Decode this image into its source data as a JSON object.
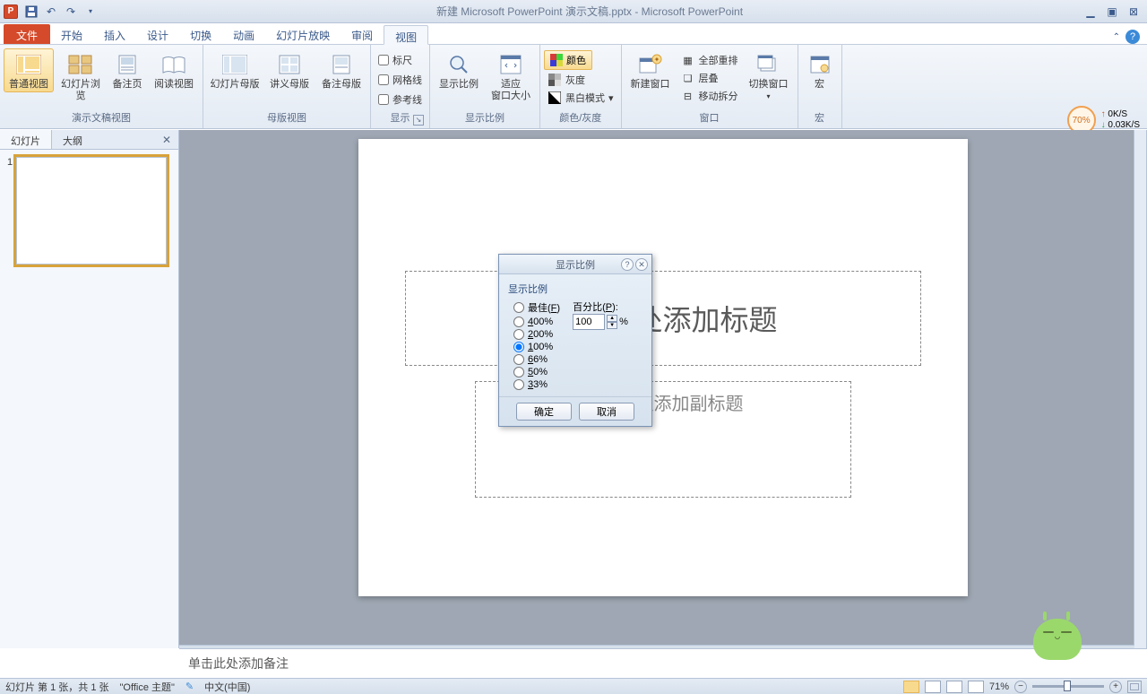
{
  "title_bar": {
    "app_letter": "P",
    "document_title": "新建 Microsoft PowerPoint 演示文稿.pptx - Microsoft PowerPoint"
  },
  "ribbon": {
    "file_tab": "文件",
    "tabs": [
      "开始",
      "插入",
      "设计",
      "切换",
      "动画",
      "幻灯片放映",
      "审阅",
      "视图"
    ],
    "active_tab": "视图",
    "groups": {
      "presentation_views": {
        "label": "演示文稿视图",
        "normal": "普通视图",
        "sorter": "幻灯片浏览",
        "notes_page": "备注页",
        "reading": "阅读视图"
      },
      "master_views": {
        "label": "母版视图",
        "slide_master": "幻灯片母版",
        "handout_master": "讲义母版",
        "notes_master": "备注母版"
      },
      "show": {
        "label": "显示",
        "ruler": "标尺",
        "gridlines": "网格线",
        "guides": "参考线"
      },
      "zoom_group": {
        "label": "显示比例",
        "zoom": "显示比例",
        "fit": "适应\n窗口大小"
      },
      "color_grayscale": {
        "label": "颜色/灰度",
        "color": "颜色",
        "grayscale": "灰度",
        "bw": "黑白模式"
      },
      "window": {
        "label": "窗口",
        "new_window": "新建窗口",
        "arrange_all": "全部重排",
        "cascade": "层叠",
        "move_split": "移动拆分",
        "switch": "切换窗口"
      },
      "macros": {
        "label": "宏",
        "button": "宏"
      }
    }
  },
  "perf": {
    "pct": "70%",
    "up": "0K/S",
    "down": "0.03K/S"
  },
  "left_panel": {
    "tab_slides": "幻灯片",
    "tab_outline": "大纲",
    "slide_number": "1"
  },
  "slide": {
    "title_placeholder": "单击此处添加标题",
    "subtitle_placeholder": "单击此处添加副标题"
  },
  "notes": {
    "placeholder": "单击此处添加备注"
  },
  "dialog": {
    "title": "显示比例",
    "fieldset": "显示比例",
    "options": {
      "fit": {
        "label": "最佳",
        "accel": "F"
      },
      "400": "400%",
      "200": "200%",
      "100": "100%",
      "66": "66%",
      "50": "50%",
      "33": "33%"
    },
    "percent_label": "百分比",
    "percent_accel": "P",
    "percent_value": "100",
    "percent_suffix": "%",
    "selected": "100",
    "ok": "确定",
    "cancel": "取消"
  },
  "status": {
    "slide_counter": "幻灯片 第 1 张，共 1 张",
    "theme": "\"Office 主题\"",
    "language": "中文(中国)",
    "zoom_pct": "71%"
  }
}
